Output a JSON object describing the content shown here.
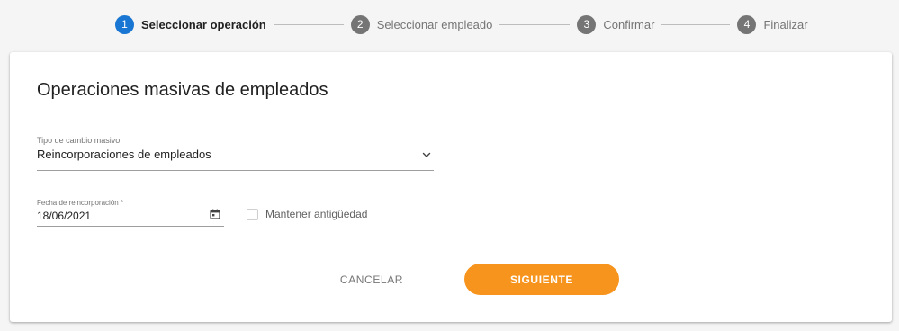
{
  "stepper": {
    "steps": [
      {
        "number": "1",
        "label": "Seleccionar operación",
        "state": "active"
      },
      {
        "number": "2",
        "label": "Seleccionar empleado",
        "state": "pending"
      },
      {
        "number": "3",
        "label": "Confirmar",
        "state": "pending"
      },
      {
        "number": "4",
        "label": "Finalizar",
        "state": "pending"
      }
    ]
  },
  "card": {
    "title": "Operaciones masivas de empleados",
    "change_type": {
      "label": "Tipo de cambio masivo",
      "value": "Reincorporaciones de empleados",
      "icon": "chevron-down-icon"
    },
    "reinstatement_date": {
      "label": "Fecha de reincorporación *",
      "value": "18/06/2021",
      "icon": "calendar-icon"
    },
    "keep_seniority": {
      "label": "Mantener antigüedad",
      "checked": false
    },
    "actions": {
      "cancel_label": "CANCELAR",
      "next_label": "SIGUIENTE"
    }
  },
  "colors": {
    "active_step": "#1976d2",
    "inactive_step": "#757575",
    "primary_button": "#f7941d",
    "background": "#f5f5f5"
  }
}
